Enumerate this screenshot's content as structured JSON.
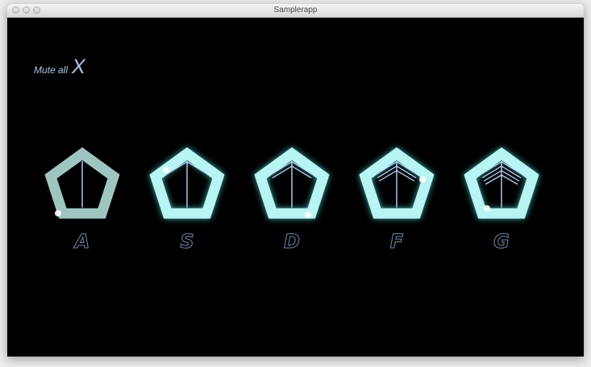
{
  "window": {
    "title": "Samplerapp"
  },
  "controls": {
    "mute_label": "Mute all",
    "mute_key": "X"
  },
  "pads": [
    {
      "key": "A",
      "active": false,
      "lines": 0
    },
    {
      "key": "S",
      "active": true,
      "lines": 1
    },
    {
      "key": "D",
      "active": true,
      "lines": 2
    },
    {
      "key": "F",
      "active": true,
      "lines": 3
    },
    {
      "key": "G",
      "active": true,
      "lines": 4
    }
  ],
  "colors": {
    "background": "#000000",
    "inactive_ring": "#9fc5c1",
    "active_ring": "#b9f4f4",
    "glow": "#56e2e4",
    "line": "#b8d5ff",
    "key_outline": "#7188aa",
    "mute_text": "#a9c7e8"
  }
}
